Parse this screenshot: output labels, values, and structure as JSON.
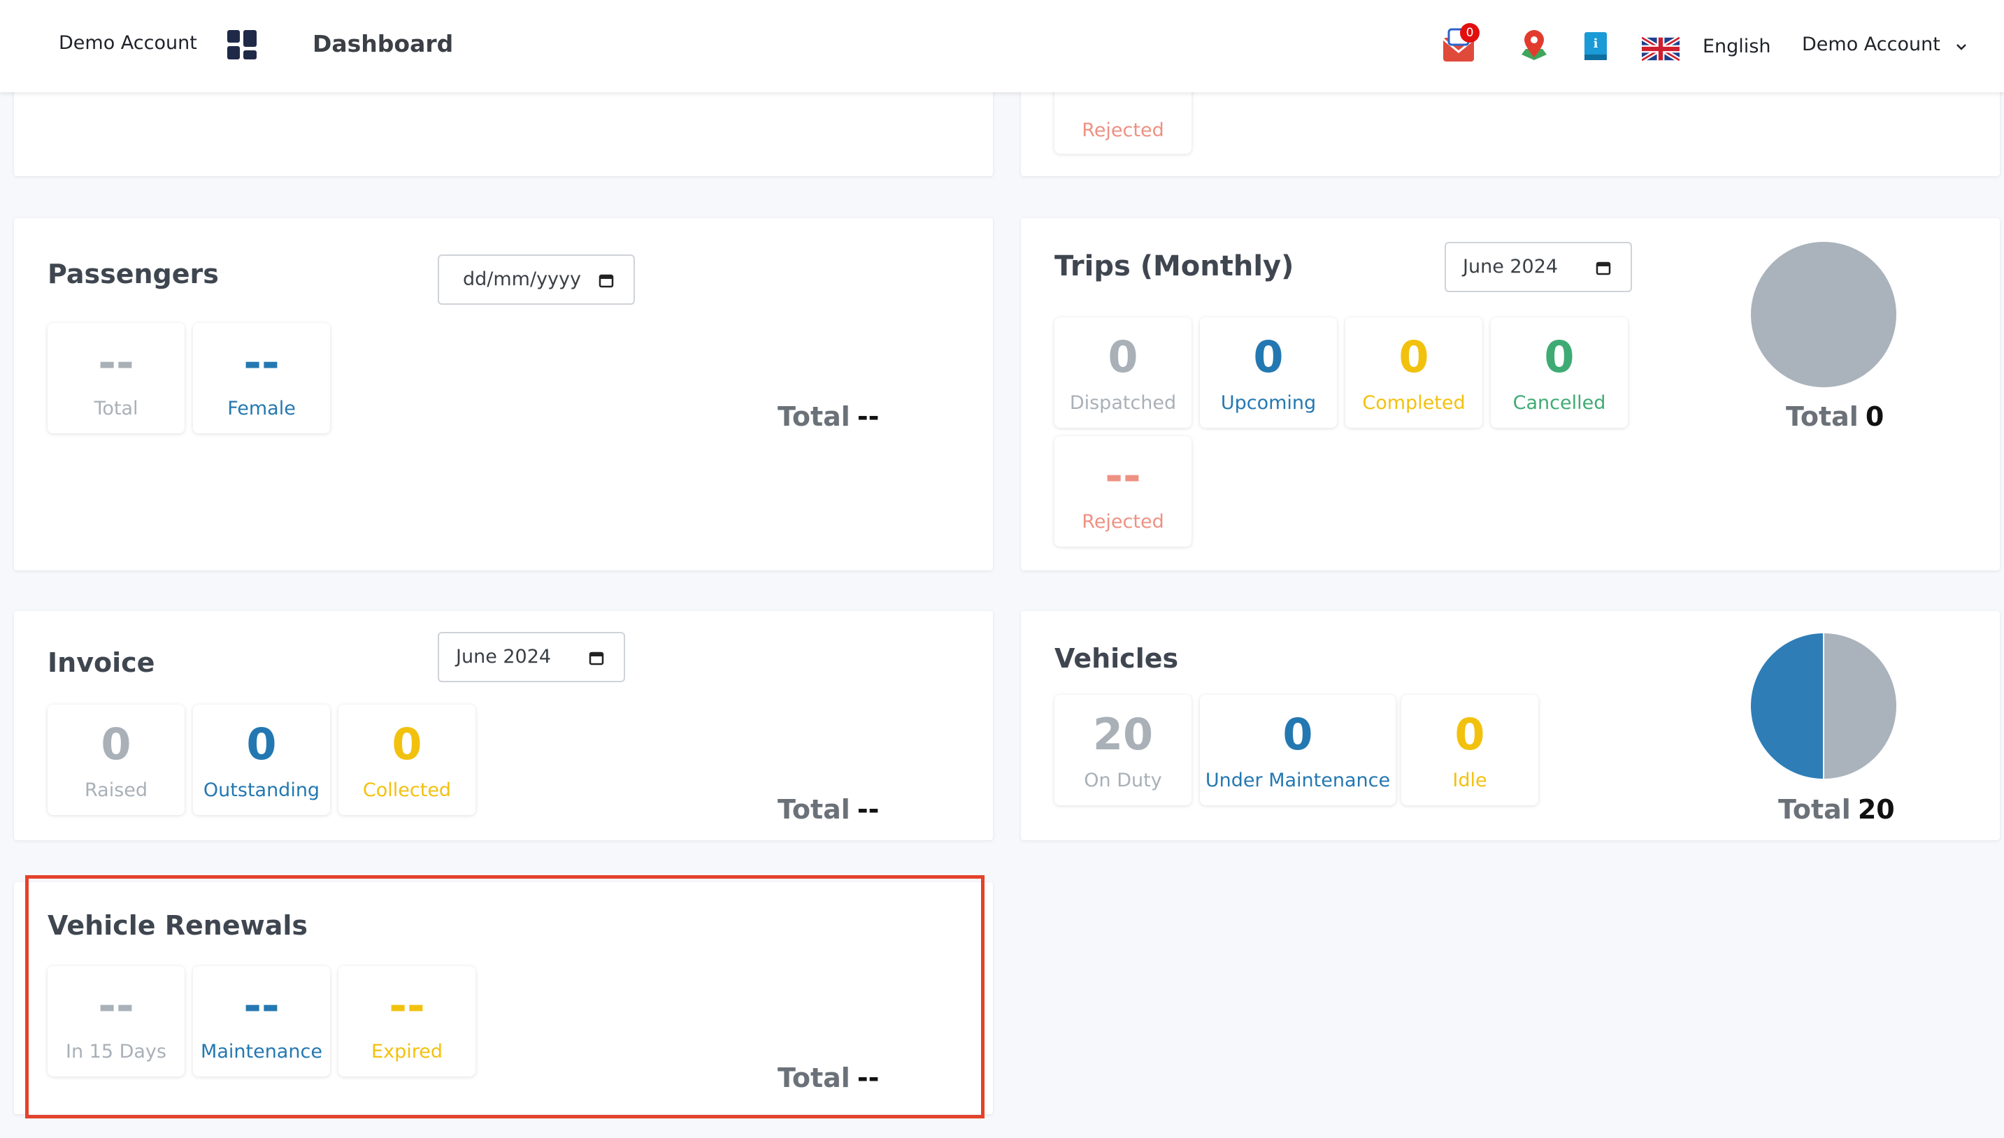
{
  "header": {
    "account_name": "Demo Account",
    "page_title": "Dashboard",
    "notification_count": "0",
    "language": "English",
    "user_menu": "Demo Account"
  },
  "top_partial": {
    "rejected_label": "Rejected"
  },
  "passengers": {
    "title": "Passengers",
    "date_placeholder": "dd/mm/yyyy",
    "stats": [
      {
        "value": "--",
        "label": "Total"
      },
      {
        "value": "--",
        "label": "Female"
      }
    ],
    "total_label": "Total",
    "total_value": "--"
  },
  "trips": {
    "title": "Trips (Monthly)",
    "month": "June 2024",
    "stats": [
      {
        "value": "0",
        "label": "Dispatched"
      },
      {
        "value": "0",
        "label": "Upcoming"
      },
      {
        "value": "0",
        "label": "Completed"
      },
      {
        "value": "0",
        "label": "Cancelled"
      },
      {
        "value": "--",
        "label": "Rejected"
      }
    ],
    "total_label": "Total",
    "total_value": "0"
  },
  "invoice": {
    "title": "Invoice",
    "month": "June 2024",
    "stats": [
      {
        "value": "0",
        "label": "Raised"
      },
      {
        "value": "0",
        "label": "Outstanding"
      },
      {
        "value": "0",
        "label": "Collected"
      }
    ],
    "total_label": "Total",
    "total_value": "--"
  },
  "vehicles": {
    "title": "Vehicles",
    "stats": [
      {
        "value": "20",
        "label": "On Duty"
      },
      {
        "value": "0",
        "label": "Under Maintenance"
      },
      {
        "value": "0",
        "label": "Idle"
      }
    ],
    "total_label": "Total",
    "total_value": "20"
  },
  "renewals": {
    "title": "Vehicle Renewals",
    "stats": [
      {
        "value": "--",
        "label": "In 15 Days"
      },
      {
        "value": "--",
        "label": "Maintenance"
      },
      {
        "value": "--",
        "label": "Expired"
      }
    ],
    "total_label": "Total",
    "total_value": "--"
  },
  "colors": {
    "grey": "#a9b0b7",
    "blue": "#2478b1",
    "yellow": "#f2c10e",
    "green": "#3fab74",
    "red": "#ee9183",
    "pie_grey": "#aab3bc",
    "pie_blue": "#2e7db7",
    "highlight": "#e3422c"
  },
  "icons": [
    "dashboard-grid-icon",
    "mail-icon",
    "map-pin-icon",
    "info-book-icon",
    "uk-flag-icon",
    "chevron-down-icon",
    "calendar-icon"
  ]
}
